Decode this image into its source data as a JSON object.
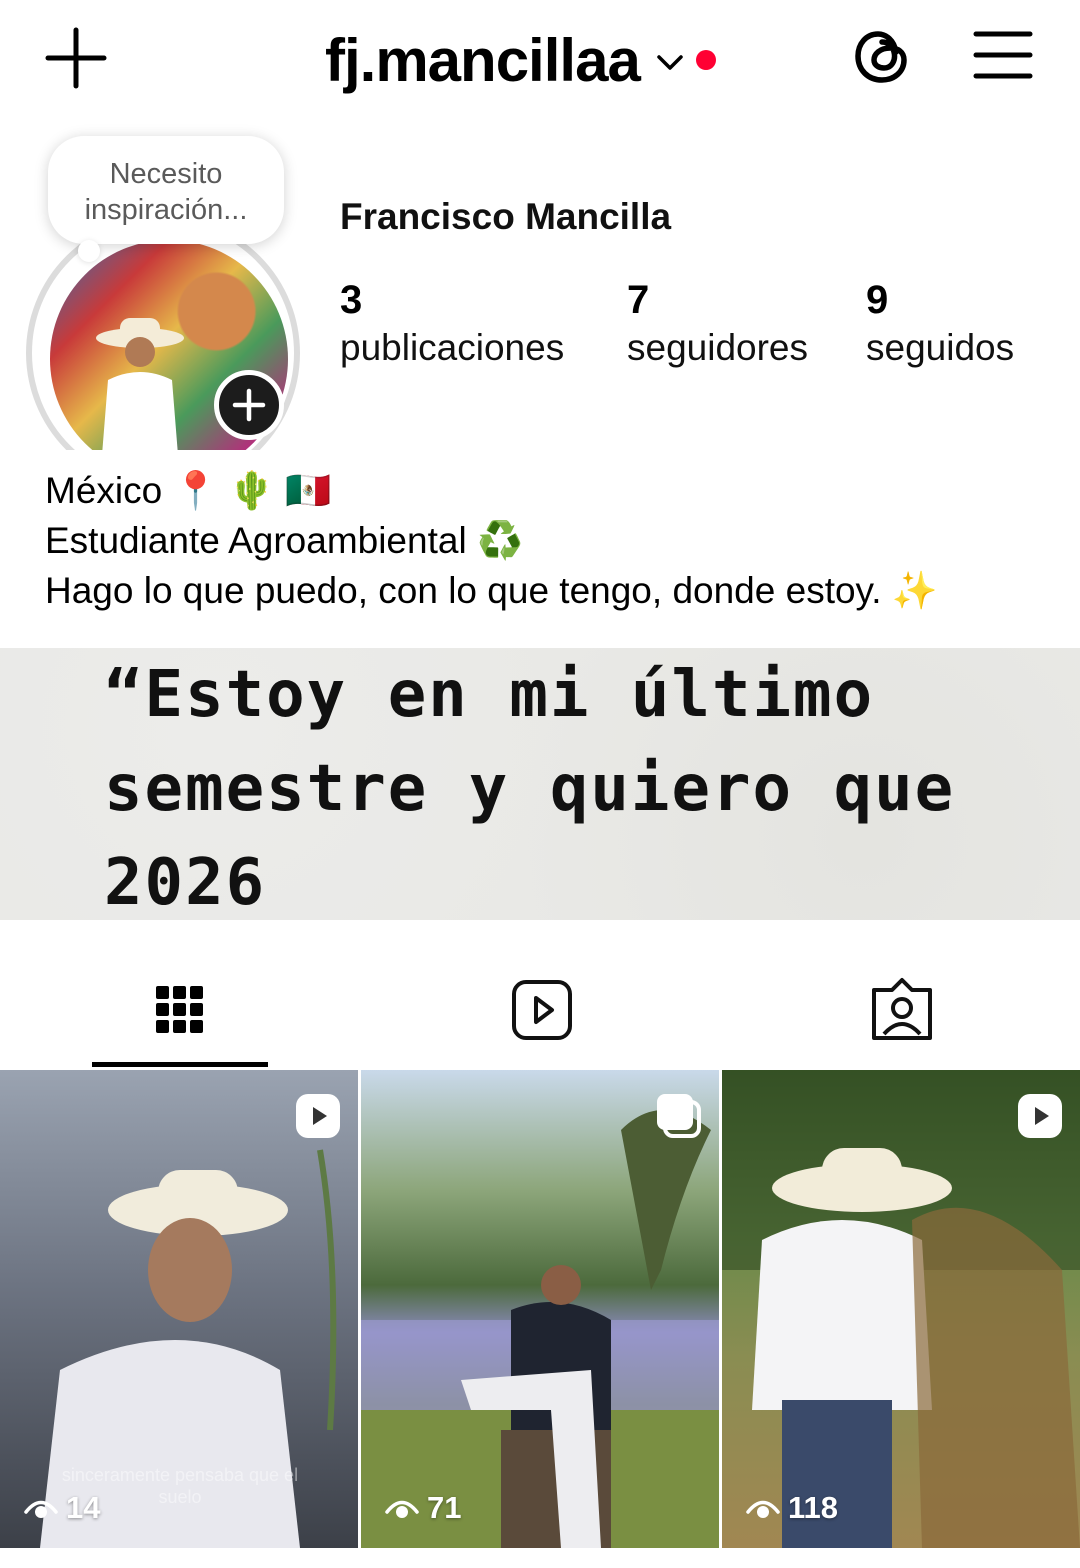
{
  "header": {
    "username": "fj.mancillaa",
    "has_notification_dot": true,
    "colors": {
      "notification_dot": "#ff0033"
    },
    "icons": [
      "plus-icon",
      "chevron-down-icon",
      "threads-icon",
      "menu-icon"
    ]
  },
  "profile": {
    "note": "Necesito\ninspiración...",
    "display_name": "Francisco Mancilla",
    "stats": [
      {
        "value": "3",
        "label": "publicaciones"
      },
      {
        "value": "7",
        "label": "seguidores"
      },
      {
        "value": "9",
        "label": "seguidos"
      }
    ],
    "bio": [
      "México 📍 🌵 🇲🇽",
      "Estudiante Agroambiental ♻️",
      "Hago lo que puedo, con lo que tengo, donde estoy. ✨"
    ]
  },
  "banner": {
    "text": "“Estoy en mi último\nsemestre y quiero que\n2026"
  },
  "tabs": [
    {
      "name": "posts",
      "icon": "grid-icon",
      "active": true
    },
    {
      "name": "reels",
      "icon": "reels-icon",
      "active": false
    },
    {
      "name": "tagged",
      "icon": "tagged-icon",
      "active": false
    }
  ],
  "posts": [
    {
      "type": "reel",
      "type_icon": "reel-badge-icon",
      "views": "14",
      "caption": "sinceramente pensaba que el\nsuelo"
    },
    {
      "type": "carousel",
      "type_icon": "carousel-badge-icon",
      "views": "71",
      "caption": ""
    },
    {
      "type": "reel",
      "type_icon": "reel-badge-icon",
      "views": "118",
      "caption": ""
    }
  ]
}
